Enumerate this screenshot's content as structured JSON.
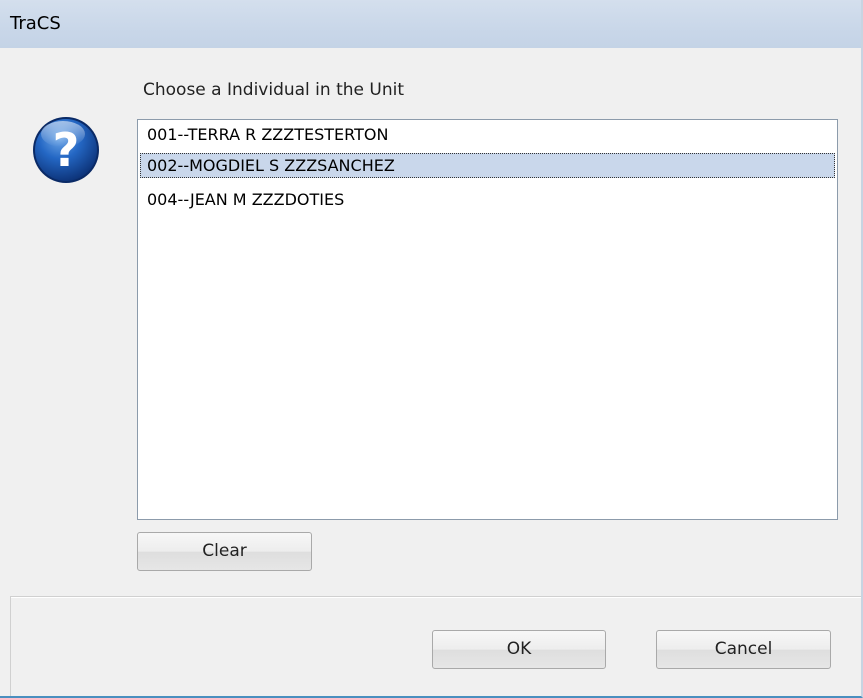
{
  "window": {
    "title": "TraCS"
  },
  "dialog": {
    "prompt": "Choose a Individual in the Unit",
    "icon": "question-icon",
    "list": {
      "items": [
        {
          "label": "001--TERRA R ZZZTESTERTON",
          "selected": false
        },
        {
          "label": "002--MOGDIEL S ZZZSANCHEZ",
          "selected": true
        },
        {
          "label": "004--JEAN M ZZZDOTIES",
          "selected": false
        }
      ]
    },
    "clear_label": "Clear",
    "ok_label": "OK",
    "cancel_label": "Cancel"
  },
  "colors": {
    "selection": "#c9d7eb",
    "titlebar": "#c9d7e9",
    "icon_blue": "#1a5fb4"
  }
}
